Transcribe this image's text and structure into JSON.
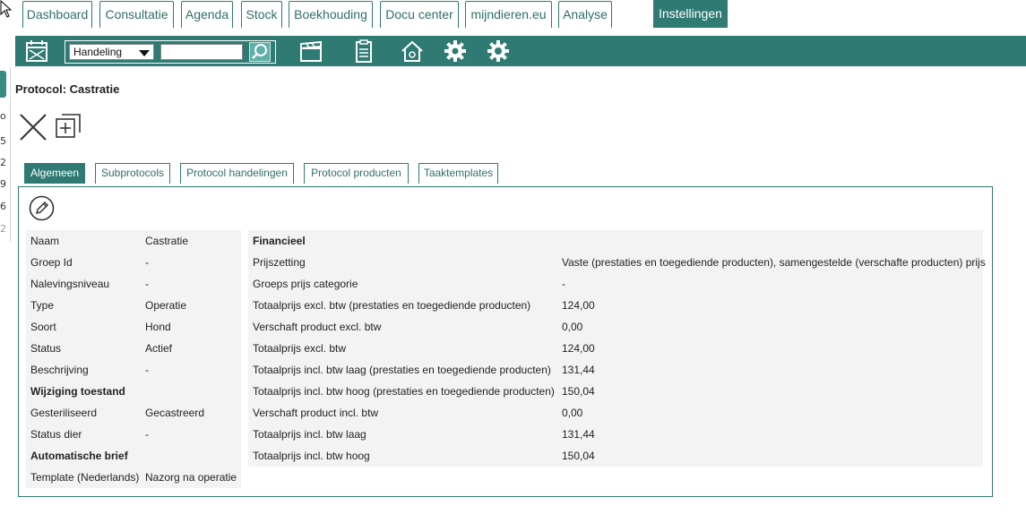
{
  "top_tabs": [
    {
      "label": "Dashboard"
    },
    {
      "label": "Consultatie"
    },
    {
      "label": "Agenda"
    },
    {
      "label": "Stock"
    },
    {
      "label": "Boekhouding"
    },
    {
      "label": "Docu center"
    },
    {
      "label": "mijndieren.eu"
    },
    {
      "label": "Analyse"
    },
    {
      "label": "Instellingen"
    }
  ],
  "active_top_tab": "Instellingen",
  "toolbar": {
    "search_type": "Handeling",
    "search_value": "",
    "icons": [
      "calendar-icon",
      "clapperboard-icon",
      "clipboard-icon",
      "home-icon",
      "gears-icon",
      "gear-icon"
    ]
  },
  "left_strip": [
    "o",
    "5",
    "2",
    "9",
    "6",
    "2"
  ],
  "page": {
    "title": "Protocol: Castratie"
  },
  "sub_tabs": [
    {
      "label": "Algemeen"
    },
    {
      "label": "Subprotocols"
    },
    {
      "label": "Protocol handelingen"
    },
    {
      "label": "Protocol producten"
    },
    {
      "label": "Taaktemplates"
    }
  ],
  "active_sub_tab": "Algemeen",
  "general": [
    {
      "label": "Naam",
      "value": "Castratie"
    },
    {
      "label": "Groep Id",
      "value": "-"
    },
    {
      "label": "Nalevingsniveau",
      "value": "-"
    },
    {
      "label": "Type",
      "value": "Operatie"
    },
    {
      "label": "Soort",
      "value": "Hond"
    },
    {
      "label": "Status",
      "value": "Actief"
    },
    {
      "label": "Beschrijving",
      "value": "-"
    },
    {
      "label": "Wijziging toestand",
      "value": "",
      "heading": true
    },
    {
      "label": "Gesteriliseerd",
      "value": "Gecastreerd"
    },
    {
      "label": "Status dier",
      "value": "-"
    },
    {
      "label": "Automatische brief",
      "value": "",
      "heading": true
    },
    {
      "label": "Template (Nederlands)",
      "value": "Nazorg na operatie"
    }
  ],
  "financial": [
    {
      "label": "Financieel",
      "value": "",
      "heading": true
    },
    {
      "label": "Prijszetting",
      "value": "Vaste (prestaties en toegediende producten), samengestelde (verschafte producten) prijs"
    },
    {
      "label": "Groeps prijs categorie",
      "value": "-"
    },
    {
      "label": "Totaalprijs excl. btw (prestaties en toegediende producten)",
      "value": "124,00"
    },
    {
      "label": "Verschaft product excl. btw",
      "value": "0,00"
    },
    {
      "label": "Totaalprijs excl. btw",
      "value": "124,00"
    },
    {
      "label": "Totaalprijs incl. btw laag (prestaties en toegediende producten)",
      "value": "131,44"
    },
    {
      "label": "Totaalprijs incl. btw hoog (prestaties en toegediende producten)",
      "value": "150,04"
    },
    {
      "label": "Verschaft product incl. btw",
      "value": "0,00"
    },
    {
      "label": "Totaalprijs incl. btw laag",
      "value": "131,44"
    },
    {
      "label": "Totaalprijs incl. btw hoog",
      "value": "150,04"
    }
  ],
  "colors": {
    "accent": "#2f7a73",
    "panel_bg": "#f3f3f3",
    "search_button": "#5fb0a8"
  }
}
